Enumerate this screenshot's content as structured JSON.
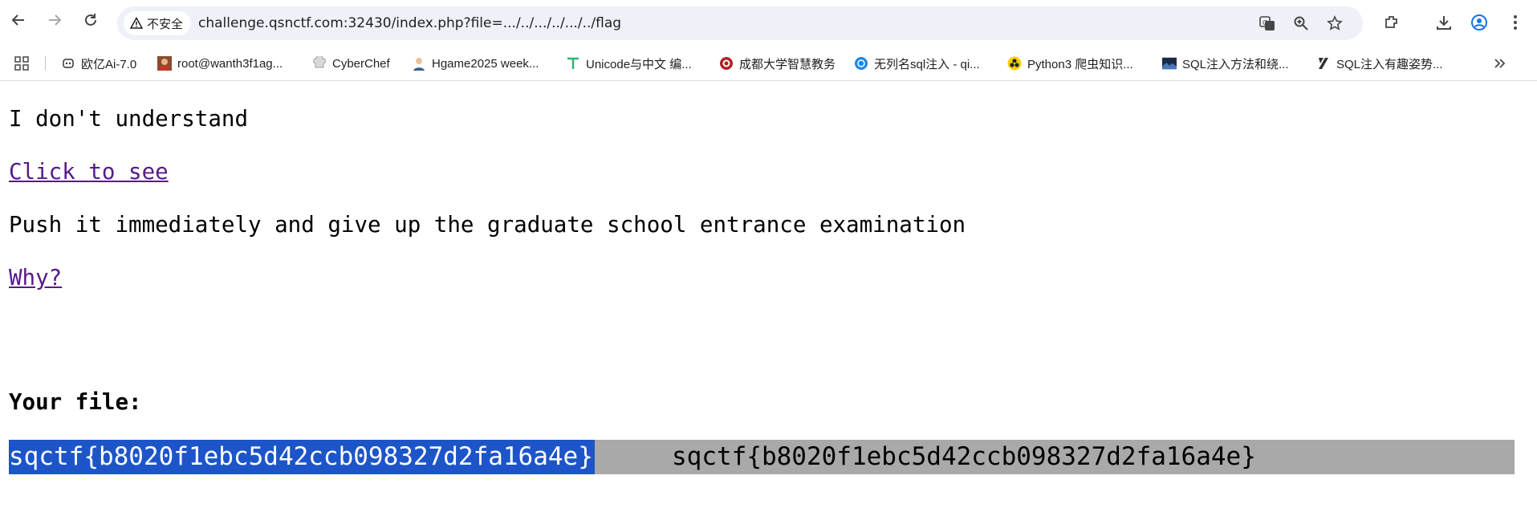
{
  "toolbar": {
    "security_label": "不安全",
    "url": "challenge.qsnctf.com:32430/index.php?file=.../../.../../.../../flag"
  },
  "bookmarks": [
    {
      "label": "欧亿Ai-7.0",
      "icon": "robot-icon"
    },
    {
      "label": "root@wanth3f1ag...",
      "icon": "avatar-icon"
    },
    {
      "label": "CyberChef",
      "icon": "chef-hat-icon"
    },
    {
      "label": "Hgame2025 week...",
      "icon": "avatar-icon"
    },
    {
      "label": "Unicode与中文 编...",
      "icon": "t-logo-icon"
    },
    {
      "label": "成都大学智慧教务",
      "icon": "seal-icon"
    },
    {
      "label": "无列名sql注入 - qi...",
      "icon": "globe-icon"
    },
    {
      "label": "Python3 爬虫知识...",
      "icon": "biohazard-icon"
    },
    {
      "label": "SQL注入方法和绕...",
      "icon": "image-icon"
    },
    {
      "label": "SQL注入有趣姿势...",
      "icon": "slash-logo-icon"
    }
  ],
  "page": {
    "line1": "I don't understand",
    "link1": "Click to see",
    "line2": "Push it immediately and give up the graduate school entrance examination",
    "link2": "Why?",
    "heading": "Your file:",
    "flag_selected": "sqctf{b8020f1ebc5d42ccb098327d2fa16a4e}",
    "flag_plain": "sqctf{b8020f1ebc5d42ccb098327d2fa16a4e}"
  },
  "colors": {
    "link": "#551a8b",
    "selection": "#1d55c9",
    "flag_background": "#a9a9a9",
    "omnibox": "#eef1f7"
  }
}
